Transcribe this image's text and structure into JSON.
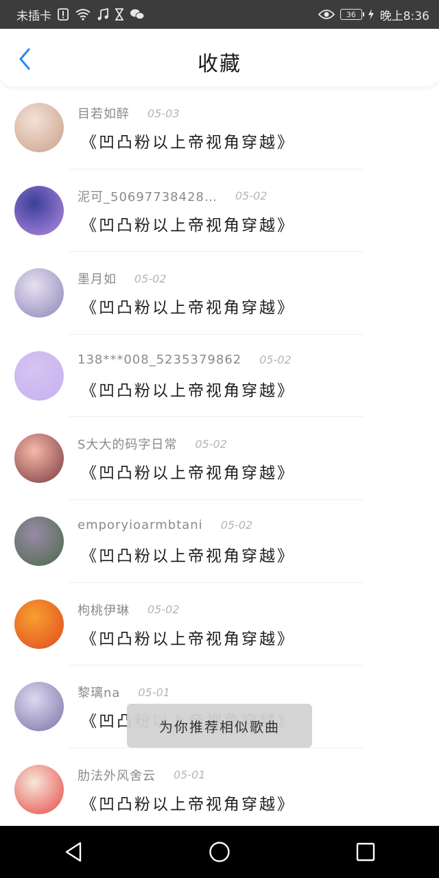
{
  "status_bar": {
    "left_text": "未插卡",
    "battery": "36",
    "time": "晚上8:36",
    "icons": [
      "sim-alert-icon",
      "wifi-icon",
      "music-icon",
      "hourglass-icon",
      "wechat-icon",
      "eye-icon",
      "charging-icon"
    ]
  },
  "header": {
    "title": "收藏",
    "back_icon": "chevron-left-icon",
    "accent_color": "#2a8cf0"
  },
  "items": [
    {
      "username": "目若如醉",
      "date": "05-03",
      "title": "《凹凸粉以上帝视角穿越》",
      "avatar_colors": [
        "#f4e1d6",
        "#c9a08a"
      ]
    },
    {
      "username": "泥可_50697738428…",
      "date": "05-02",
      "title": "《凹凸粉以上帝视角穿越》",
      "avatar_colors": [
        "#3a3f9a",
        "#b48ae0"
      ]
    },
    {
      "username": "墨月如",
      "date": "05-02",
      "title": "《凹凸粉以上帝视角穿越》",
      "avatar_colors": [
        "#e6e0f2",
        "#8e86b8"
      ]
    },
    {
      "username": "138***008_5235379862",
      "date": "05-02",
      "title": "《凹凸粉以上帝视角穿越》",
      "avatar_colors": [
        "#d6c4f2",
        "#c6b0ee"
      ]
    },
    {
      "username": "S大大的码字日常",
      "date": "05-02",
      "title": "《凹凸粉以上帝视角穿越》",
      "avatar_colors": [
        "#f5b8a8",
        "#7a3a40"
      ]
    },
    {
      "username": "emporyioarmbtani",
      "date": "05-02",
      "title": "《凹凸粉以上帝视角穿越》",
      "avatar_colors": [
        "#9a8aa8",
        "#4a6a48"
      ]
    },
    {
      "username": "枸桃伊琳",
      "date": "05-02",
      "title": "《凹凸粉以上帝视角穿越》",
      "avatar_colors": [
        "#f7a030",
        "#e04a20"
      ]
    },
    {
      "username": "黎璃na",
      "date": "05-01",
      "title": "《凹凸粉以上帝视角穿越》",
      "avatar_colors": [
        "#dcd8f0",
        "#7a74a8"
      ]
    },
    {
      "username": "肋法外风舍云",
      "date": "05-01",
      "title": "《凹凸粉以上帝视角穿越》",
      "avatar_colors": [
        "#f5e8d8",
        "#e8484a"
      ]
    }
  ],
  "toast": {
    "text": "为你推荐相似歌曲"
  },
  "nav": {
    "back_icon": "triangle-back-icon",
    "home_icon": "circle-home-icon",
    "recents_icon": "square-recents-icon"
  }
}
